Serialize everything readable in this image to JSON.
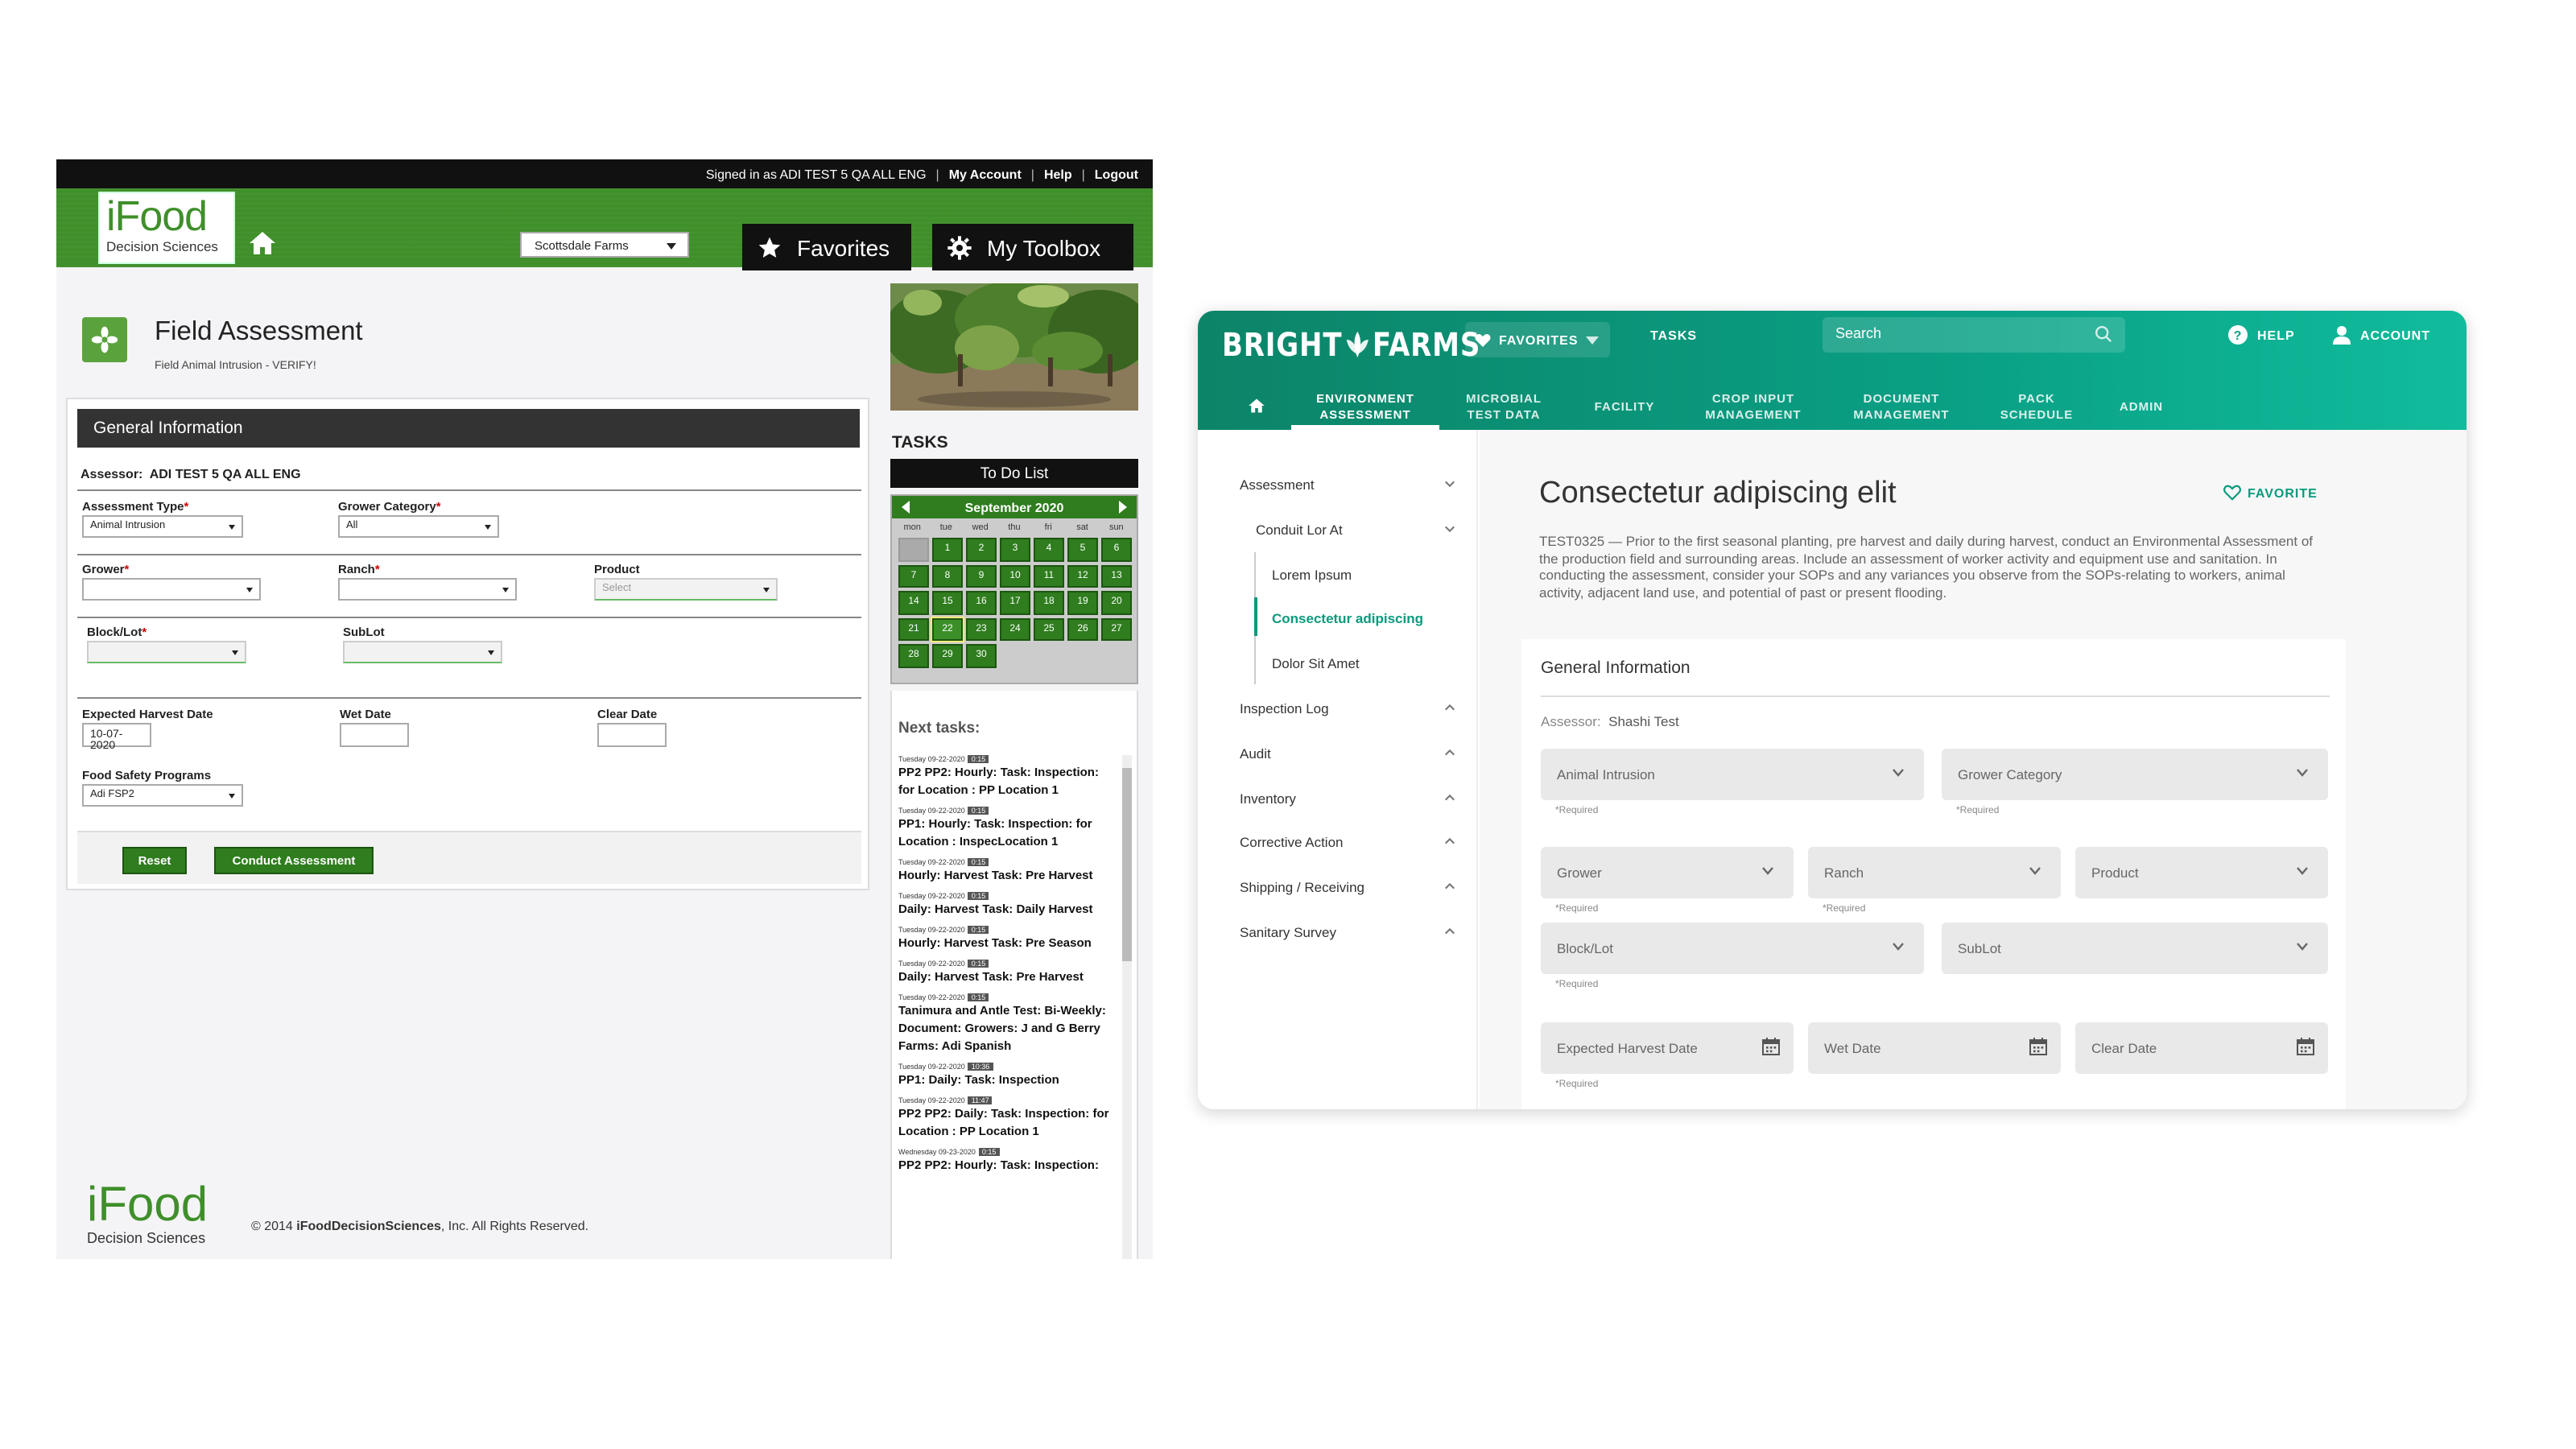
{
  "ifood": {
    "topbar": {
      "signed_in": "Signed in as ADI TEST 5 QA ALL ENG",
      "sep": "|",
      "my_account": "My Account",
      "help": "Help",
      "logout": "Logout"
    },
    "logo": {
      "big": "iFood",
      "small": "Decision Sciences"
    },
    "farm_select": "Scottsdale Farms",
    "favorites": "Favorites",
    "toolbox": "My Toolbox",
    "page_title": "Field Assessment",
    "page_subtitle": "Field Animal Intrusion - VERIFY!",
    "form": {
      "section": "General Information",
      "assessor_label": "Assessor:",
      "assessor_value": "ADI TEST 5 QA ALL ENG",
      "assessment_type_label": "Assessment Type",
      "assessment_type_value": "Animal Intrusion",
      "grower_category_label": "Grower Category",
      "grower_category_value": "All",
      "grower_label": "Grower",
      "ranch_label": "Ranch",
      "product_label": "Product",
      "product_value": "Select",
      "block_label": "Block/Lot",
      "sublot_label": "SubLot",
      "expected_harvest_label": "Expected Harvest Date",
      "expected_harvest_value": "10-07-2020",
      "wet_date_label": "Wet Date",
      "clear_date_label": "Clear Date",
      "fsp_label": "Food Safety Programs",
      "fsp_value": "Adi FSP2",
      "required_mark": "*",
      "reset": "Reset",
      "conduct": "Conduct Assessment"
    },
    "footer": {
      "logo_big": "iFood",
      "logo_small": "Decision Sciences",
      "copy_pre": "© 2014 ",
      "copy_brand": "iFoodDecisionSciences",
      "copy_post": ", Inc. All Rights Reserved."
    },
    "tasks_label": "TASKS",
    "todo": "To Do List",
    "calendar": {
      "month": "September 2020",
      "dow": [
        "mon",
        "tue",
        "wed",
        "thu",
        "fri",
        "sat",
        "sun"
      ],
      "days": [
        "",
        "1",
        "2",
        "3",
        "4",
        "5",
        "6",
        "7",
        "8",
        "9",
        "10",
        "11",
        "12",
        "13",
        "14",
        "15",
        "16",
        "17",
        "18",
        "19",
        "20",
        "21",
        "22",
        "23",
        "24",
        "25",
        "26",
        "27",
        "28",
        "29",
        "30"
      ]
    },
    "next_tasks_title": "Next tasks:",
    "tasks": [
      {
        "date": "Tuesday 09-22-2020",
        "time": "0:15",
        "text": "PP2 PP2: Hourly: Task: Inspection: for Location : PP Location 1"
      },
      {
        "date": "Tuesday 09-22-2020",
        "time": "0:15",
        "text": "PP1: Hourly: Task: Inspection: for Location : InspecLocation 1"
      },
      {
        "date": "Tuesday 09-22-2020",
        "time": "0:15",
        "text": "Hourly: Harvest Task: Pre Harvest"
      },
      {
        "date": "Tuesday 09-22-2020",
        "time": "0:15",
        "text": "Daily: Harvest Task: Daily Harvest"
      },
      {
        "date": "Tuesday 09-22-2020",
        "time": "0:15",
        "text": "Hourly: Harvest Task: Pre Season"
      },
      {
        "date": "Tuesday 09-22-2020",
        "time": "0:15",
        "text": "Daily: Harvest Task: Pre Harvest"
      },
      {
        "date": "Tuesday 09-22-2020",
        "time": "0:15",
        "text": "Tanimura and Antle Test: Bi-Weekly: Document: Growers: J and G Berry Farms: Adi Spanish"
      },
      {
        "date": "Tuesday 09-22-2020",
        "time": "10:36",
        "text": "PP1: Daily: Task: Inspection"
      },
      {
        "date": "Tuesday 09-22-2020",
        "time": "11:47",
        "text": "PP2 PP2: Daily: Task: Inspection: for Location : PP Location 1"
      },
      {
        "date": "Wednesday 09-23-2020",
        "time": "0:15",
        "text": "PP2 PP2: Hourly: Task: Inspection:"
      }
    ]
  },
  "brightfarms": {
    "logo_left": "BRIGHT",
    "logo_right": "FARMS",
    "favorites": "FAVORITES",
    "tasks": "TASKS",
    "search_placeholder": "Search",
    "help": "HELP",
    "account": "ACCOUNT",
    "nav": [
      {
        "line1": "ENVIRONMENT",
        "line2": "ASSESSMENT"
      },
      {
        "line1": "MICROBIAL",
        "line2": "TEST DATA"
      },
      {
        "line1": "FACILITY",
        "line2": ""
      },
      {
        "line1": "CROP INPUT",
        "line2": "MANAGEMENT"
      },
      {
        "line1": "DOCUMENT",
        "line2": "MANAGEMENT"
      },
      {
        "line1": "PACK",
        "line2": "SCHEDULE"
      },
      {
        "line1": "ADMIN",
        "line2": ""
      }
    ],
    "sidebar": {
      "assessment": "Assessment",
      "conduit": "Conduit Lor At",
      "lorem": "Lorem Ipsum",
      "consectetur": "Consectetur adipiscing",
      "dolor": "Dolor Sit Amet",
      "inspection_log": "Inspection Log",
      "audit": "Audit",
      "inventory": "Inventory",
      "corrective_action": "Corrective Action",
      "shipping": "Shipping / Receiving",
      "sanitary": "Sanitary Survey"
    },
    "title": "Consectetur adipiscing elit",
    "favorite_link": "FAVORITE",
    "description": "TEST0325 — Prior to the first seasonal planting, pre harvest and daily during harvest, conduct an Environmental Assessment of the production field and surrounding areas. Include an assessment of worker activity and equipment use and sanitation. In conducting the assessment, consider your SOPs and any variances you observe from the SOPs-relating to workers, animal activity, adjacent land use, and potential of past or present flooding.",
    "card": {
      "title": "General Information",
      "assessor_label": "Assessor:",
      "assessor_value": "Shashi Test",
      "animal_intrusion": "Animal Intrusion",
      "grower_category": "Grower Category",
      "grower": "Grower",
      "ranch": "Ranch",
      "product": "Product",
      "block": "Block/Lot",
      "sublot": "SubLot",
      "expected_harvest": "Expected Harvest Date",
      "wet_date": "Wet Date",
      "clear_date": "Clear Date",
      "required": "*Required"
    },
    "accent_color": "#0a9a7c"
  }
}
